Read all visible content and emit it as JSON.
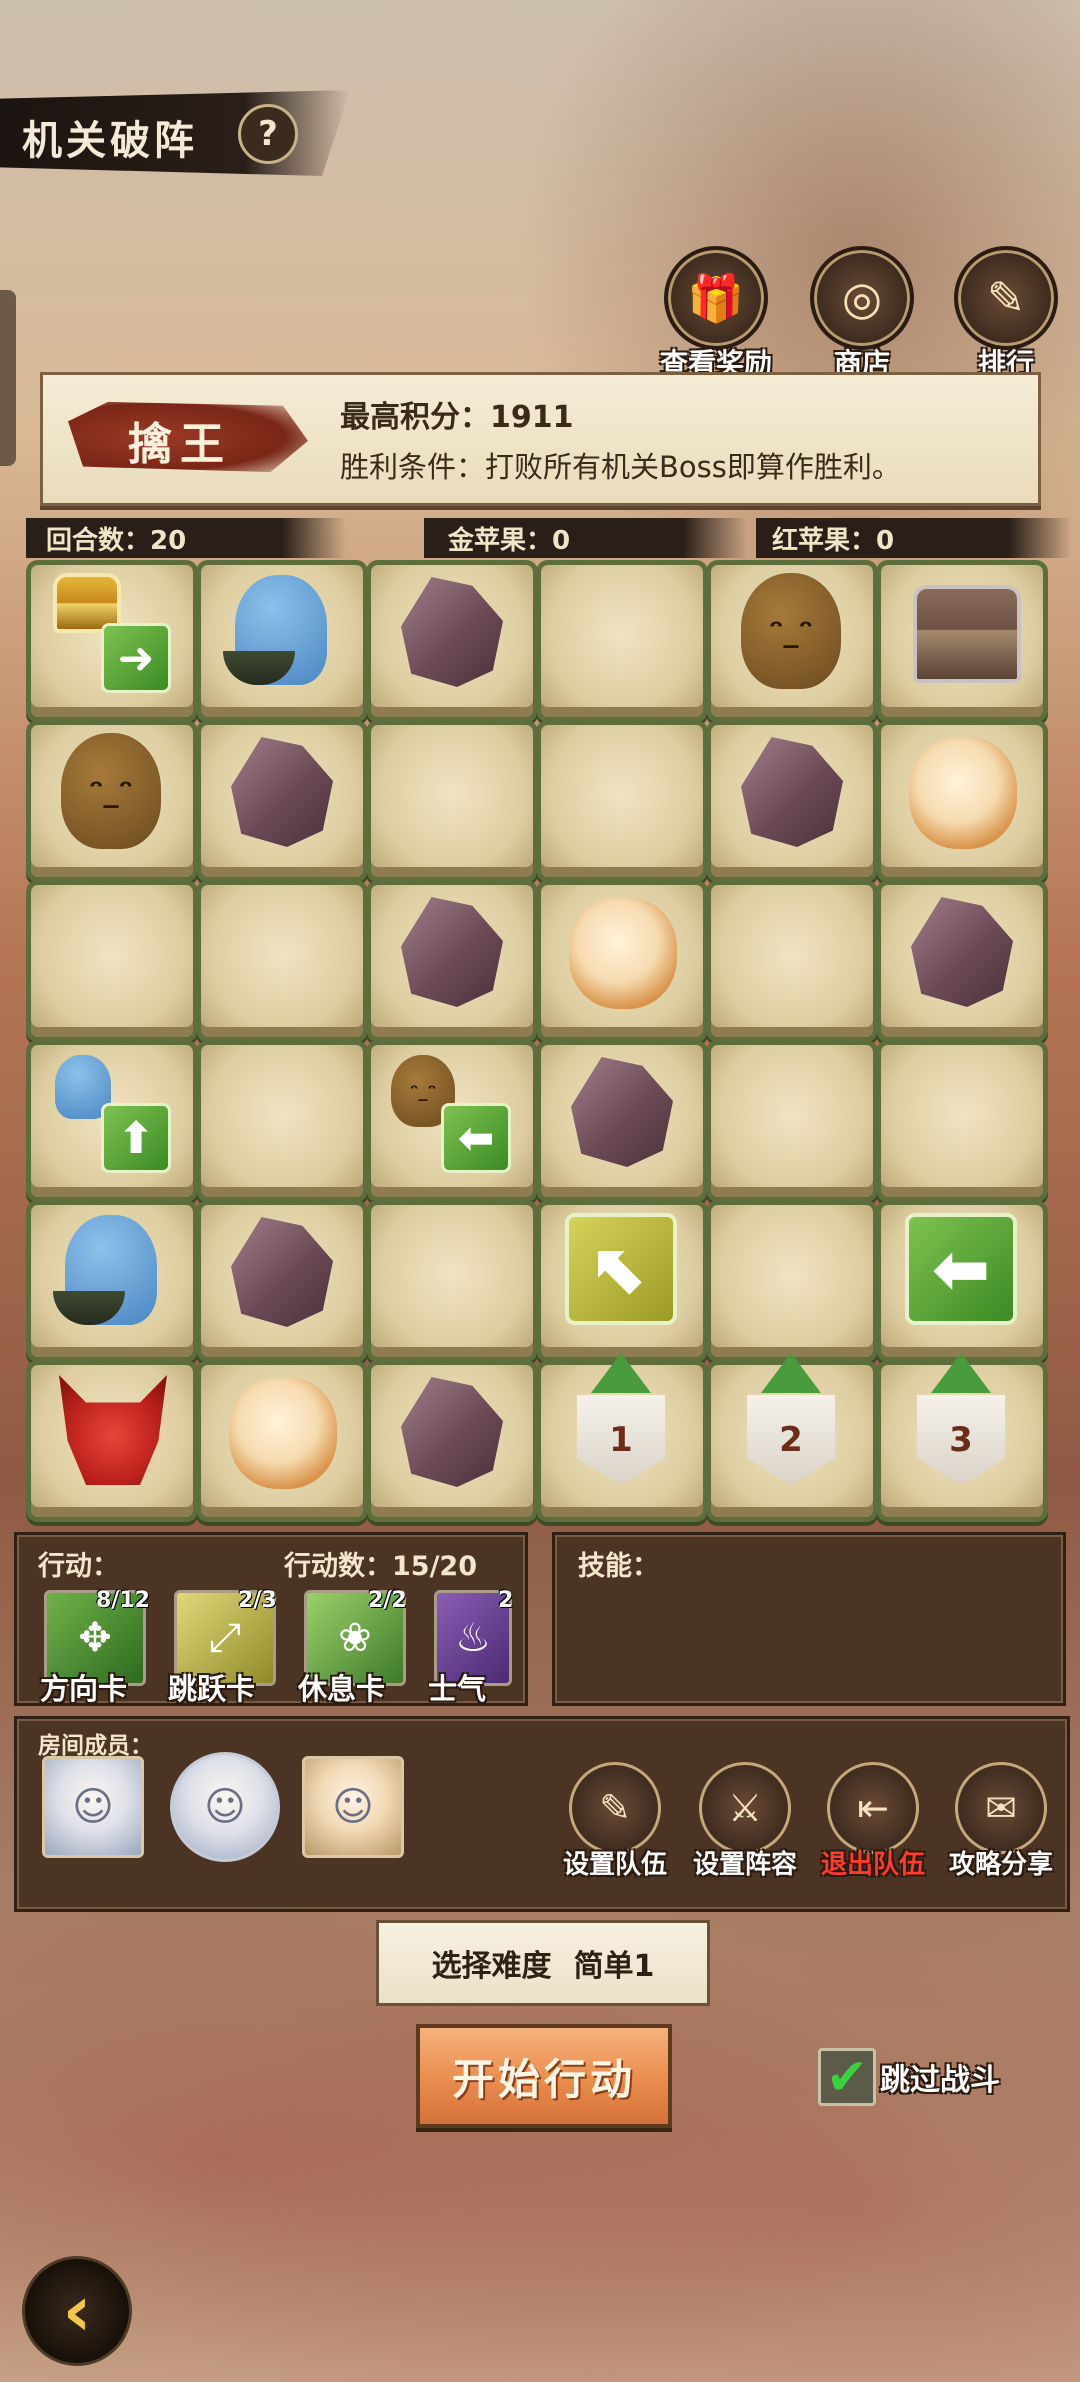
{
  "header": {
    "title": "机关破阵",
    "help_label": "?"
  },
  "top_buttons": [
    {
      "label": "查看奖励",
      "icon": "gift-icon",
      "glyph": "🎁"
    },
    {
      "label": "商店",
      "icon": "shop-icon",
      "glyph": "◎"
    },
    {
      "label": "排行",
      "icon": "ranking-icon",
      "glyph": "✎"
    }
  ],
  "info": {
    "mode": "擒王",
    "score_text": "最高积分：1911",
    "win_text": "胜利条件：打败所有机关Boss即算作胜利。"
  },
  "stats": {
    "rounds": "回合数：20",
    "gold_apples": "金苹果：0",
    "red_apples": "红苹果：0"
  },
  "board": {
    "rows": [
      [
        "chest-arrow-right",
        "walrus",
        "rock",
        "empty",
        "boulder",
        "chest"
      ],
      [
        "boulder",
        "rock",
        "empty",
        "empty",
        "rock",
        "dog"
      ],
      [
        "empty",
        "empty",
        "rock",
        "dog",
        "empty",
        "rock"
      ],
      [
        "walrus-arrow-up",
        "empty",
        "boulder-arrow-left",
        "rock",
        "empty",
        "empty"
      ],
      [
        "walrus",
        "rock",
        "empty",
        "arrow-upleft",
        "empty",
        "arrow-left"
      ],
      [
        "mask",
        "dog",
        "rock",
        "flag-1",
        "flag-2",
        "flag-3"
      ]
    ],
    "flags": [
      "1",
      "2",
      "3"
    ]
  },
  "actions": {
    "label": "行动：",
    "count_label": "行动数：15/20",
    "cards": [
      {
        "label": "方向卡",
        "count": "8/12",
        "icon": "direction-card-icon",
        "glyph": "✥"
      },
      {
        "label": "跳跃卡",
        "count": "2/3",
        "icon": "jump-card-icon",
        "glyph": "⤢"
      },
      {
        "label": "休息卡",
        "count": "2/2",
        "icon": "rest-card-icon",
        "glyph": "❀"
      },
      {
        "label": "士气",
        "count": "2",
        "icon": "morale-card-icon",
        "glyph": "♨"
      }
    ]
  },
  "skills": {
    "label": "技能："
  },
  "room": {
    "label": "房间成员：",
    "members": [
      "member-1",
      "member-2",
      "member-3"
    ],
    "buttons": [
      {
        "label": "设置队伍",
        "icon": "team-setup-icon",
        "glyph": "✎",
        "red": false
      },
      {
        "label": "设置阵容",
        "icon": "lineup-icon",
        "glyph": "⚔",
        "red": false
      },
      {
        "label": "退出队伍",
        "icon": "exit-team-icon",
        "glyph": "⇤",
        "red": true
      },
      {
        "label": "攻略分享",
        "icon": "share-guide-icon",
        "glyph": "✉",
        "red": false
      }
    ]
  },
  "difficulty": {
    "label": "选择难度",
    "value": "简单1"
  },
  "start_label": "开始行动",
  "skip_battle": {
    "label": "跳过战斗",
    "checked": true
  },
  "back_glyph": "‹"
}
